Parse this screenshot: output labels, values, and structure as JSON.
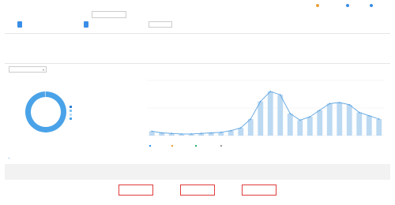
{
  "header": {
    "title": "",
    "links": [
      {
        "label": "",
        "icon": "help-icon",
        "color": "#e8a23b"
      },
      {
        "label": "",
        "icon": "share-icon",
        "color": "#3a8ee6"
      },
      {
        "label": "",
        "icon": "download-icon",
        "color": "#3a8ee6"
      }
    ]
  },
  "filters": {
    "time_label": "",
    "time_options": [
      "",
      "",
      "",
      ""
    ],
    "date_range": "",
    "compare_label": "",
    "device_label": "",
    "device_options": [
      "",
      "",
      ""
    ],
    "visitor_label": "",
    "visitor_options": [
      "",
      "",
      ""
    ],
    "region_label": "",
    "region_value": ""
  },
  "metrics": [
    {
      "label": "",
      "value": ""
    },
    {
      "label": "",
      "value": ""
    },
    {
      "label": "",
      "value": ""
    },
    {
      "label": "",
      "value": ""
    },
    {
      "label": "",
      "value": ""
    }
  ],
  "dropdown": {
    "value": ""
  },
  "donut": {
    "main_pct_label": "",
    "legend": [
      "",
      "",
      "",
      ""
    ],
    "colors": [
      "#4aa3e8",
      "#2e7fd6",
      "#7fc4f2",
      "#bfe1f8"
    ],
    "values": [
      98.5,
      0.6,
      0.5,
      0.4
    ]
  },
  "chart_data": {
    "type": "bar",
    "x": [
      "",
      "",
      "",
      "",
      "",
      "",
      "",
      "",
      "",
      "",
      "",
      "",
      "",
      "",
      "",
      "",
      "",
      "",
      "",
      "",
      "",
      "",
      "",
      ""
    ],
    "series": [
      {
        "name": "",
        "values": [
          8,
          5,
          4,
          3,
          3,
          4,
          5,
          6,
          9,
          14,
          30,
          62,
          80,
          74,
          40,
          28,
          34,
          46,
          58,
          60,
          56,
          42,
          36,
          30
        ],
        "color": "#bcd9f2"
      },
      {
        "name": "",
        "values": [
          8,
          5,
          4,
          3,
          3,
          4,
          5,
          6,
          9,
          14,
          30,
          62,
          80,
          74,
          40,
          28,
          34,
          46,
          58,
          60,
          56,
          42,
          36,
          30
        ],
        "color": "#5ea4e0"
      }
    ],
    "legend": [
      "",
      "",
      "",
      ""
    ],
    "legend_colors": [
      "#3a8ee6",
      "#e8a23b",
      "#2fb56a",
      "#9e9e9e"
    ],
    "ylim": [
      0,
      100
    ]
  },
  "table": {
    "add_link": "",
    "group1": "",
    "group2": "",
    "col_source": "",
    "col_pv": "",
    "col_uv": "",
    "col_ip": "",
    "col_bounce": "",
    "col_avg": "",
    "row": {
      "index": "",
      "name": "",
      "action": "",
      "pv": "",
      "uv": "",
      "ip": "",
      "bounce": "",
      "avg": ""
    }
  }
}
